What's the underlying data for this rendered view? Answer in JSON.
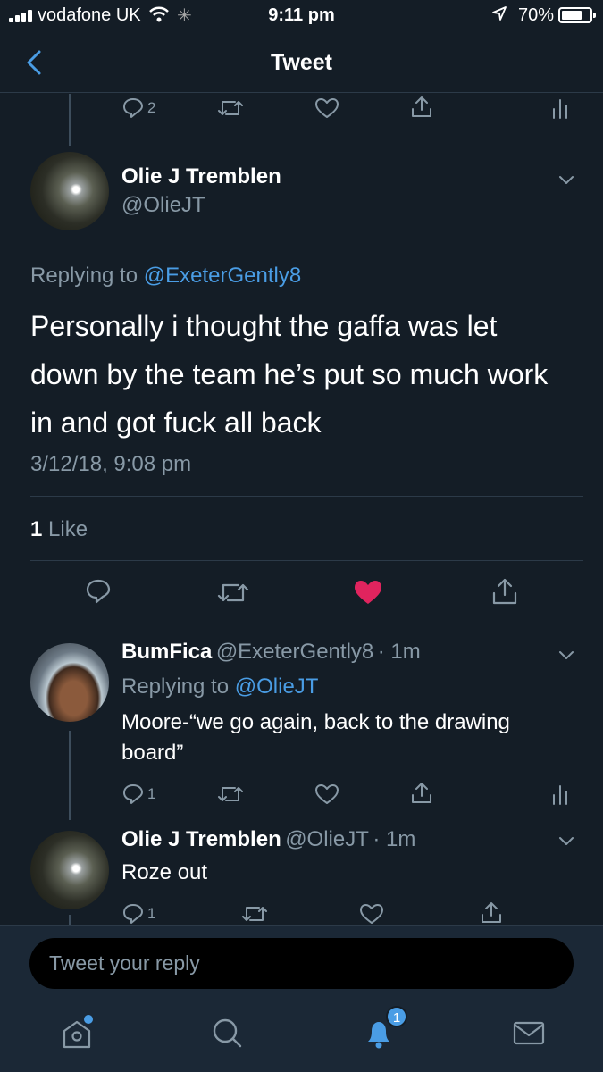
{
  "status_bar": {
    "carrier": "vodafone UK",
    "time": "9:11 pm",
    "battery": "70%",
    "battery_level": 0.7
  },
  "nav": {
    "title": "Tweet"
  },
  "parent_actions": {
    "reply_count": "2"
  },
  "main_tweet": {
    "name": "Olie J Tremblen",
    "handle": "@OlieJT",
    "replying_prefix": "Replying to",
    "replying_to": "@ExeterGently8",
    "text": "Personally i thought the gaffa was let down by the team he’s put so much work in and got fuck all back",
    "timestamp": "3/12/18, 9:08 pm",
    "likes_count": "1",
    "likes_label": "Like",
    "liked": true
  },
  "replies": [
    {
      "name": "BumFica",
      "handle": "@ExeterGently8",
      "time": "· 1m",
      "replying_prefix": "Replying to",
      "replying_to": "@OlieJT",
      "text": "Moore-“we go again, back to the drawing board”",
      "reply_count": "1"
    },
    {
      "name": "Olie J Tremblen",
      "handle": "@OlieJT",
      "time": "· 1m",
      "text": "Roze out",
      "reply_count": "1"
    }
  ],
  "reply_box": {
    "placeholder": "Tweet your reply"
  },
  "tab_bar": {
    "notifications_badge": "1",
    "tabs": [
      "home-icon",
      "search-icon",
      "bell-icon",
      "mail-icon"
    ]
  },
  "colors": {
    "background": "#141d26",
    "accent": "#4a9de5",
    "secondary_text": "#8899a6",
    "like": "#e0245e"
  }
}
